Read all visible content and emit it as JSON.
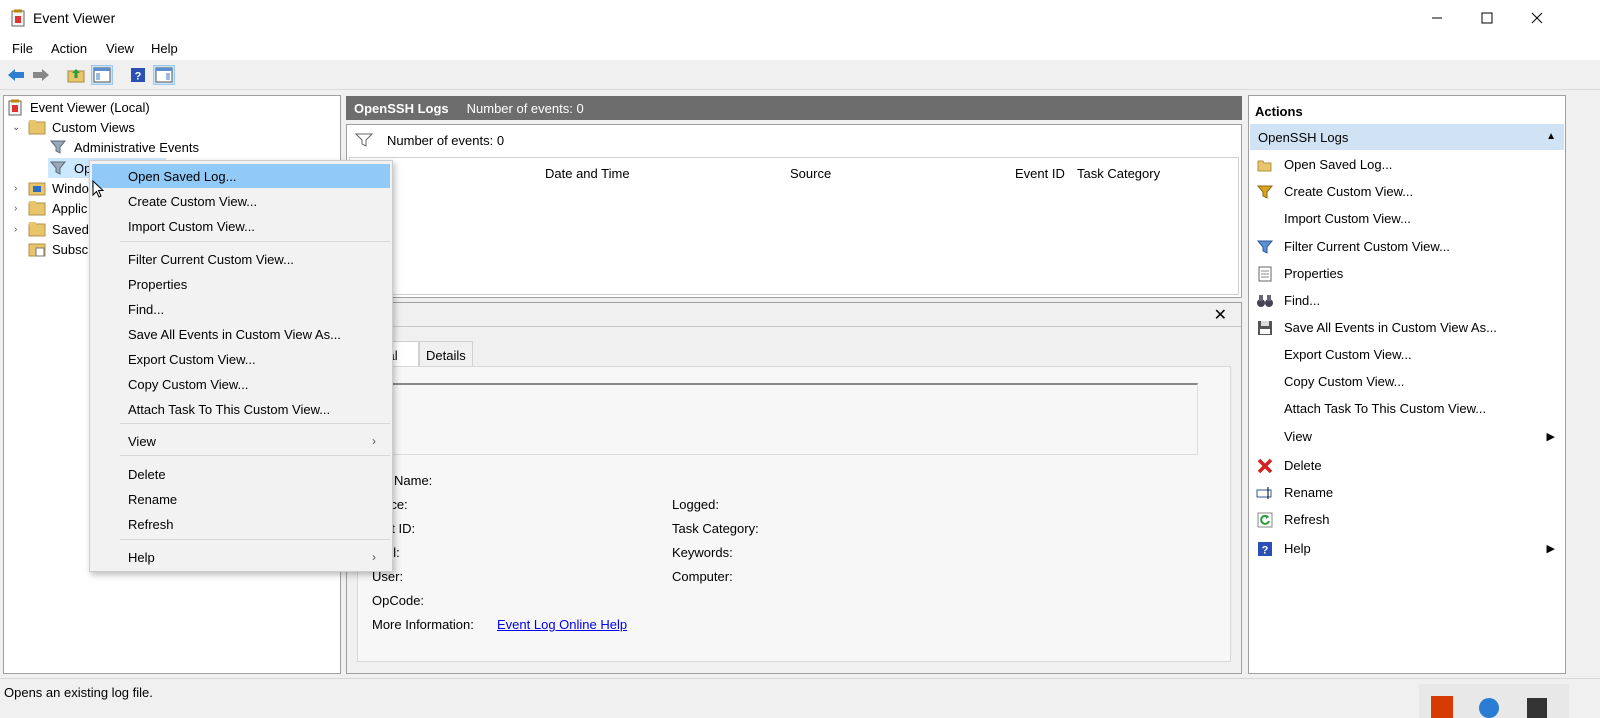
{
  "window": {
    "title": "Event Viewer"
  },
  "menu": [
    "File",
    "Action",
    "View",
    "Help"
  ],
  "tree": {
    "root": "Event Viewer (Local)",
    "custom_views": "Custom Views",
    "admin_events": "Administrative Events",
    "openssh_partial": "Op",
    "windows_logs_partial": "Windo",
    "app_logs_partial": "Applic",
    "saved_logs_partial": "Saved",
    "subscriptions_partial": "Subsc"
  },
  "events_header": {
    "name": "OpenSSH Logs",
    "count": "Number of events: 0"
  },
  "filter": {
    "count": "Number of events: 0"
  },
  "columns": [
    "Date and Time",
    "Source",
    "Event ID",
    "Task Category"
  ],
  "details": {
    "tabs": {
      "general_partial": "eral",
      "details": "Details"
    },
    "fields": {
      "log_name": "Name:",
      "source": "rce:",
      "event_id": "nt ID:",
      "level": "el:",
      "user": "User:",
      "opcode": "OpCode:",
      "more_info": "More Information:",
      "logged": "Logged:",
      "task_category": "Task Category:",
      "keywords": "Keywords:",
      "computer": "Computer:"
    },
    "link": "Event Log Online Help"
  },
  "context_menu": [
    "Open Saved Log...",
    "Create Custom View...",
    "Import Custom View...",
    "Filter Current Custom View...",
    "Properties",
    "Find...",
    "Save All Events in Custom View As...",
    "Export Custom View...",
    "Copy Custom View...",
    "Attach Task To This Custom View...",
    "View",
    "Delete",
    "Rename",
    "Refresh",
    "Help"
  ],
  "actions": {
    "title": "Actions",
    "section": "OpenSSH Logs",
    "items": [
      "Open Saved Log...",
      "Create Custom View...",
      "Import Custom View...",
      "Filter Current Custom View...",
      "Properties",
      "Find...",
      "Save All Events in Custom View As...",
      "Export Custom View...",
      "Copy Custom View...",
      "Attach Task To This Custom View...",
      "View",
      "Delete",
      "Rename",
      "Refresh",
      "Help"
    ]
  },
  "status": "Opens an existing log file."
}
